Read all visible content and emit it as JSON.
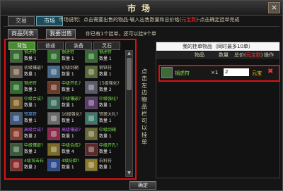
{
  "window": {
    "title": "市场",
    "close_label": "×"
  },
  "top_tabs": [
    {
      "label": "交易",
      "active": false
    },
    {
      "label": "市场",
      "active": true
    }
  ],
  "description": {
    "prefix": "市场说明：点击需要出售的物品-输入出售数量和总价格(",
    "highlight": "元宝数",
    "suffix": ")-点击确定挂单完成"
  },
  "buttons": {
    "goods_list": "商品列表",
    "my_sales": "我要出售",
    "confirm": "确定"
  },
  "info": "你已有1个挂单，还可以挂9个单",
  "bag": {
    "tabs": [
      {
        "label": "背包",
        "active": true
      },
      {
        "label": "普通",
        "active": false
      },
      {
        "label": "装备",
        "active": false
      },
      {
        "label": "灵石",
        "active": false
      }
    ],
    "items": [
      {
        "name": "钢虎符",
        "qty": "数量 1",
        "color": "#2e6e2a",
        "name_color": "#7be04a"
      },
      {
        "name": "钢虎符",
        "qty": "数量 1",
        "color": "#2e6e2a",
        "name_color": "#7be04a"
      },
      {
        "name": "钢虎符",
        "qty": "数量 1",
        "color": "#2e6e2a",
        "name_color": "#7be04a"
      },
      {
        "name": "初级镶嵌?",
        "qty": "数量 1",
        "color": "#6a5a4a",
        "name_color": "#d0c8b0"
      },
      {
        "name": "初级剑鞘",
        "qty": "数量 1",
        "color": "#4a6a8a",
        "name_color": "#d0c8b0"
      },
      {
        "name": "钢铁符",
        "qty": "数量 1",
        "color": "#5a6a3a",
        "name_color": "#d0c8b0"
      },
      {
        "name": "钢虎符",
        "qty": "数量 2",
        "color": "#2e6e2a",
        "name_color": "#7be04a"
      },
      {
        "name": "中级开孔?",
        "qty": "数量 1",
        "color": "#6a3a2a",
        "name_color": "#7be04a"
      },
      {
        "name": "15级强化?",
        "qty": "数量 2",
        "color": "#5a5a6a",
        "name_color": "#d0c8b0"
      },
      {
        "name": "中级合成?",
        "qty": "数量 1",
        "color": "#7a5a20",
        "name_color": "#7be04a"
      },
      {
        "name": "中级镶嵌?",
        "qty": "数量 1",
        "color": "#3a6a5a",
        "name_color": "#7be04a"
      },
      {
        "name": "中级强化?",
        "qty": "数量 1",
        "color": "#5a3a6a",
        "name_color": "#7be04a"
      },
      {
        "name": "铁英符",
        "qty": "数量 1",
        "color": "#3a5a8a",
        "name_color": "#6ab4ff"
      },
      {
        "name": "16级强化?",
        "qty": "数量 1",
        "color": "#6a6a6a",
        "name_color": "#d0c8b0"
      },
      {
        "name": "铁搓大礼?",
        "qty": "数量 1",
        "color": "#3a7a6a",
        "name_color": "#d0c8b0"
      },
      {
        "name": "高级合成?",
        "qty": "数量 2",
        "color": "#8a3a2a",
        "name_color": "#c060ff"
      },
      {
        "name": "高级镶嵌?",
        "qty": "数量 1",
        "color": "#8a2a4a",
        "name_color": "#c060ff"
      },
      {
        "name": "中级剑鞘",
        "qty": "数量 1",
        "color": "#6a6a3a",
        "name_color": "#7be04a"
      },
      {
        "name": "中级镶嵌?",
        "qty": "数量 2",
        "color": "#3a5a3a",
        "name_color": "#7be04a"
      },
      {
        "name": "中级合成?",
        "qty": "数量 4",
        "color": "#7a6a2a",
        "name_color": "#7be04a"
      },
      {
        "name": "中级开孔?",
        "qty": "数量 1",
        "color": "#5a2a2a",
        "name_color": "#7be04a"
      },
      {
        "name": "4级攻击石",
        "qty": "数量 2",
        "color": "#8a2a2a",
        "name_color": "#7be04a"
      },
      {
        "name": "4级防御?",
        "qty": "数量 1",
        "color": "#2a4a8a",
        "name_color": "#7be04a"
      },
      {
        "name": "石料符",
        "qty": "数量 1",
        "color": "#8a7a2a",
        "name_color": "#d0c8b0"
      }
    ]
  },
  "hint": "点击左边物品栏可以挂单",
  "listing": {
    "title": "我的挂单物品（同时最多10单）",
    "columns": {
      "item": "物品",
      "qty": "数量",
      "price_prefix": "总价(",
      "price_red": "元宝数",
      "price_suffix": ")",
      "action": "操作"
    },
    "row": {
      "name": "钢虎符",
      "qty": "×1",
      "price": "2",
      "currency": "元宝",
      "delete": "✖"
    }
  }
}
